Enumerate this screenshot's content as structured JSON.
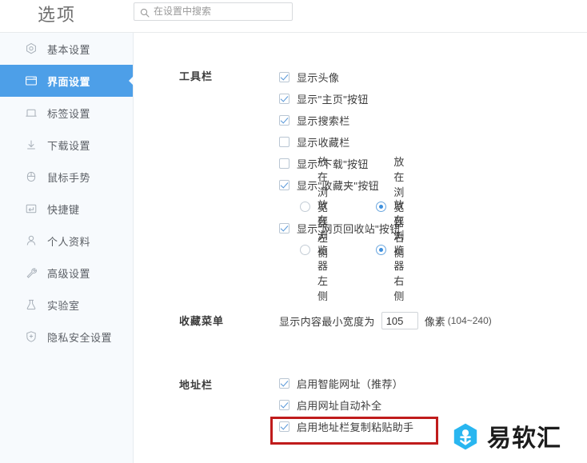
{
  "header": {
    "title": "选项",
    "search": {
      "placeholder": "在设置中搜索",
      "value": "",
      "icon": "search-icon"
    }
  },
  "sidebar": {
    "items": [
      {
        "label": "基本设置",
        "icon": "hexagon-gear-icon",
        "active": false
      },
      {
        "label": "界面设置",
        "icon": "window-icon",
        "active": true
      },
      {
        "label": "标签设置",
        "icon": "tab-icon",
        "active": false
      },
      {
        "label": "下载设置",
        "icon": "download-arrow-icon",
        "active": false
      },
      {
        "label": "鼠标手势",
        "icon": "mouse-icon",
        "active": false
      },
      {
        "label": "快捷键",
        "icon": "keyboard-enter-icon",
        "active": false
      },
      {
        "label": "个人资料",
        "icon": "person-icon",
        "active": false
      },
      {
        "label": "高级设置",
        "icon": "wrench-icon",
        "active": false
      },
      {
        "label": "实验室",
        "icon": "flask-icon",
        "active": false
      },
      {
        "label": "隐私安全设置",
        "icon": "shield-plus-icon",
        "active": false
      }
    ]
  },
  "main": {
    "sections": {
      "toolbar": {
        "title": "工具栏",
        "checkboxes": [
          {
            "label": "显示头像",
            "checked": true
          },
          {
            "label": "显示\"主页\"按钮",
            "checked": true
          },
          {
            "label": "显示搜索栏",
            "checked": true
          },
          {
            "label": "显示收藏栏",
            "checked": false
          },
          {
            "label": "显示\"下载\"按钮",
            "checked": false
          },
          {
            "label": "显示\"收藏夹\"按钮",
            "checked": true
          }
        ],
        "favorites_position": {
          "left_label": "放在浏览器左侧",
          "right_label": "放在浏览器右侧",
          "selected": "right"
        },
        "recycle_checkbox": {
          "label": "显示\"网页回收站\"按钮",
          "checked": true
        },
        "recycle_position": {
          "left_label": "放在浏览器左侧",
          "right_label": "放在浏览器右侧",
          "selected": "right"
        }
      },
      "favorites_menu": {
        "title": "收藏菜单",
        "width_prefix": "显示内容最小宽度为",
        "width_value": "105",
        "unit": "像素",
        "range": "(104~240)"
      },
      "address_bar": {
        "title": "地址栏",
        "checkboxes": [
          {
            "label": "启用智能网址（推荐）",
            "checked": true
          },
          {
            "label": "启用网址自动补全",
            "checked": true
          },
          {
            "label": "启用地址栏复制粘贴助手",
            "checked": true
          }
        ]
      }
    }
  },
  "annotation": {
    "highlight_color": "#c01c1c",
    "highlight_target": "启用地址栏复制粘贴助手"
  },
  "watermark": {
    "text": "易软汇",
    "logo_color": "#29b6f0"
  },
  "theme": {
    "accent": "#4d9fe8",
    "sidebar_bg": "#f7fafd",
    "checkbox_check": "#5596d8",
    "radio_fill": "#3d8fdd"
  }
}
